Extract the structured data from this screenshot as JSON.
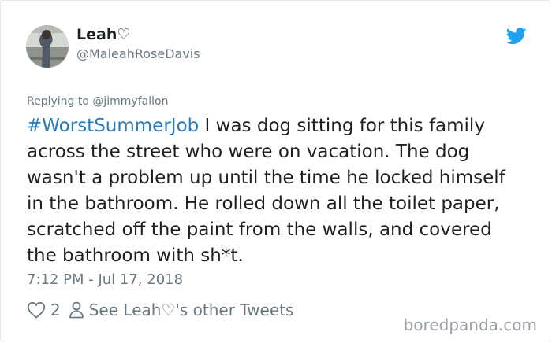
{
  "author": {
    "display_name": "Leah♡",
    "handle": "@MaleahRoseDavis"
  },
  "platform_icon": "twitter-bird-icon",
  "reply": {
    "label": "Replying to @jimmyfallon"
  },
  "tweet": {
    "hashtag": "#WorstSummerJob",
    "line1_rest": " I was dog sitting for this family",
    "line2": "across the street who were on vacation. The dog",
    "line3": "wasn't a problem up until the time he locked himself",
    "line4": "in the bathroom. He rolled down all the toilet paper,",
    "line5": "scratched off the paint from the walls, and covered",
    "line6": "the bathroom with sh*t."
  },
  "timestamp": "7:12 PM - Jul 17, 2018",
  "actions": {
    "like_icon": "heart-icon",
    "like_count": "2",
    "profile_icon": "person-icon",
    "profile_label": "See Leah♡'s other Tweets"
  },
  "watermark": "boredpanda.com",
  "colors": {
    "link": "#2b7bb9",
    "bird": "#1da1f2",
    "secondary_text": "#697882"
  }
}
